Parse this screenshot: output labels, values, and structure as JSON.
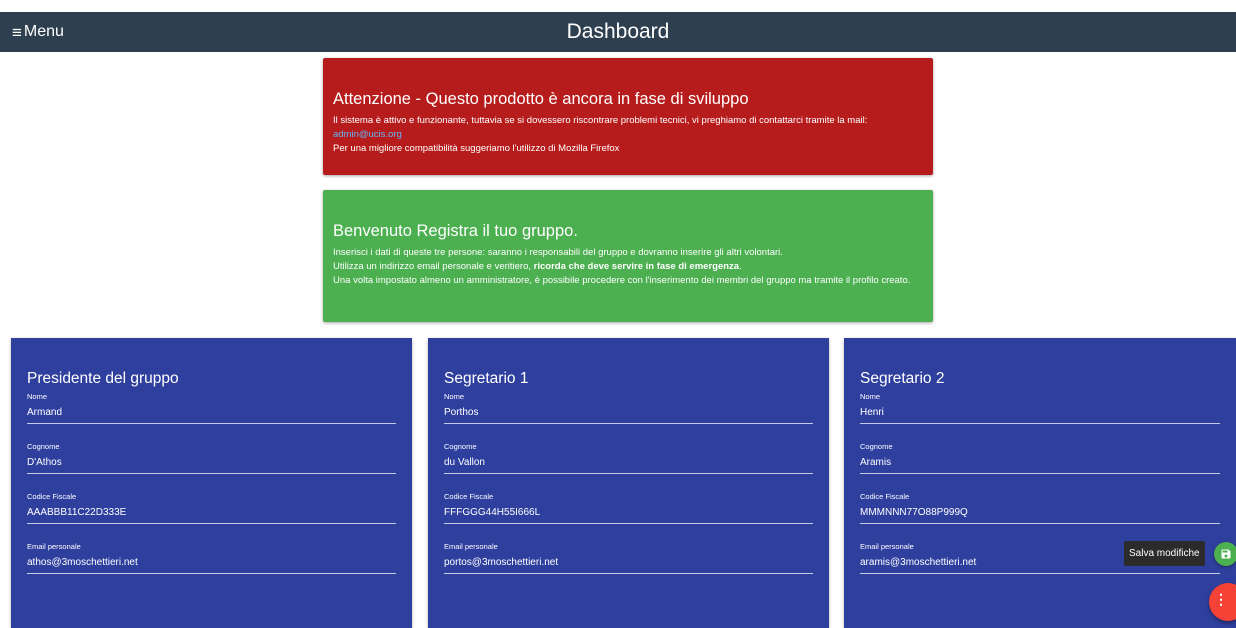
{
  "header": {
    "menu_label": "Menu",
    "menu_icon": "≡",
    "title": "Dashboard"
  },
  "alert_warning": {
    "title": "Attenzione - Questo prodotto è ancora in fase di sviluppo",
    "line1": "Il sistema è attivo e funzionante, tuttavia se si dovessero riscontrare problemi tecnici, vi preghiamo di contattarci tramite la mail:",
    "email": "admin@ucis.org",
    "line2": "Per una migliore compatibilità suggeriamo l'utilizzo di Mozilla Firefox",
    "color": "#b71c1c"
  },
  "alert_welcome": {
    "title": "Benvenuto Registra il tuo gruppo.",
    "line1": "Inserisci i dati di queste tre persone: saranno i responsabili del gruppo e dovranno inserire gli altri volontari.",
    "line2_plain": "Utilizza un indirizzo email personale e veritiero, ",
    "line2_bold": "ricorda che deve servire in fase di emergenza",
    "line2_end": ".",
    "line3": "Una volta impostato almeno un amministratore, è possibile procedere con l'inserimento dei membri del gruppo ma tramite il profilo creato.",
    "color": "#4caf50"
  },
  "labels": {
    "nome": "Nome",
    "cognome": "Cognome",
    "codice_fiscale": "Codice Fiscale",
    "email": "Email personale"
  },
  "cards": [
    {
      "title": "Presidente del gruppo",
      "nome": "Armand",
      "cognome": "D'Athos",
      "codice_fiscale": "AAABBB11C22D333E",
      "email": "athos@3moschettieri.net"
    },
    {
      "title": "Segretario 1",
      "nome": "Porthos",
      "cognome": "du Vallon",
      "codice_fiscale": "FFFGGG44H55I666L",
      "email": "portos@3moschettieri.net"
    },
    {
      "title": "Segretario 2",
      "nome": "Henri",
      "cognome": "Aramis",
      "codice_fiscale": "MMMNNN77O88P999Q",
      "email": "aramis@3moschettieri.net"
    }
  ],
  "fab": {
    "save_tooltip": "Salva modifiche",
    "save_icon": "floppy-disk-icon",
    "main_icon": "more-vert-icon",
    "main_glyph": "⋮"
  },
  "colors": {
    "topbar": "#2e3f4f",
    "card": "#2f3f9e",
    "fab_save": "#4caf50",
    "fab_main": "#f44336"
  }
}
